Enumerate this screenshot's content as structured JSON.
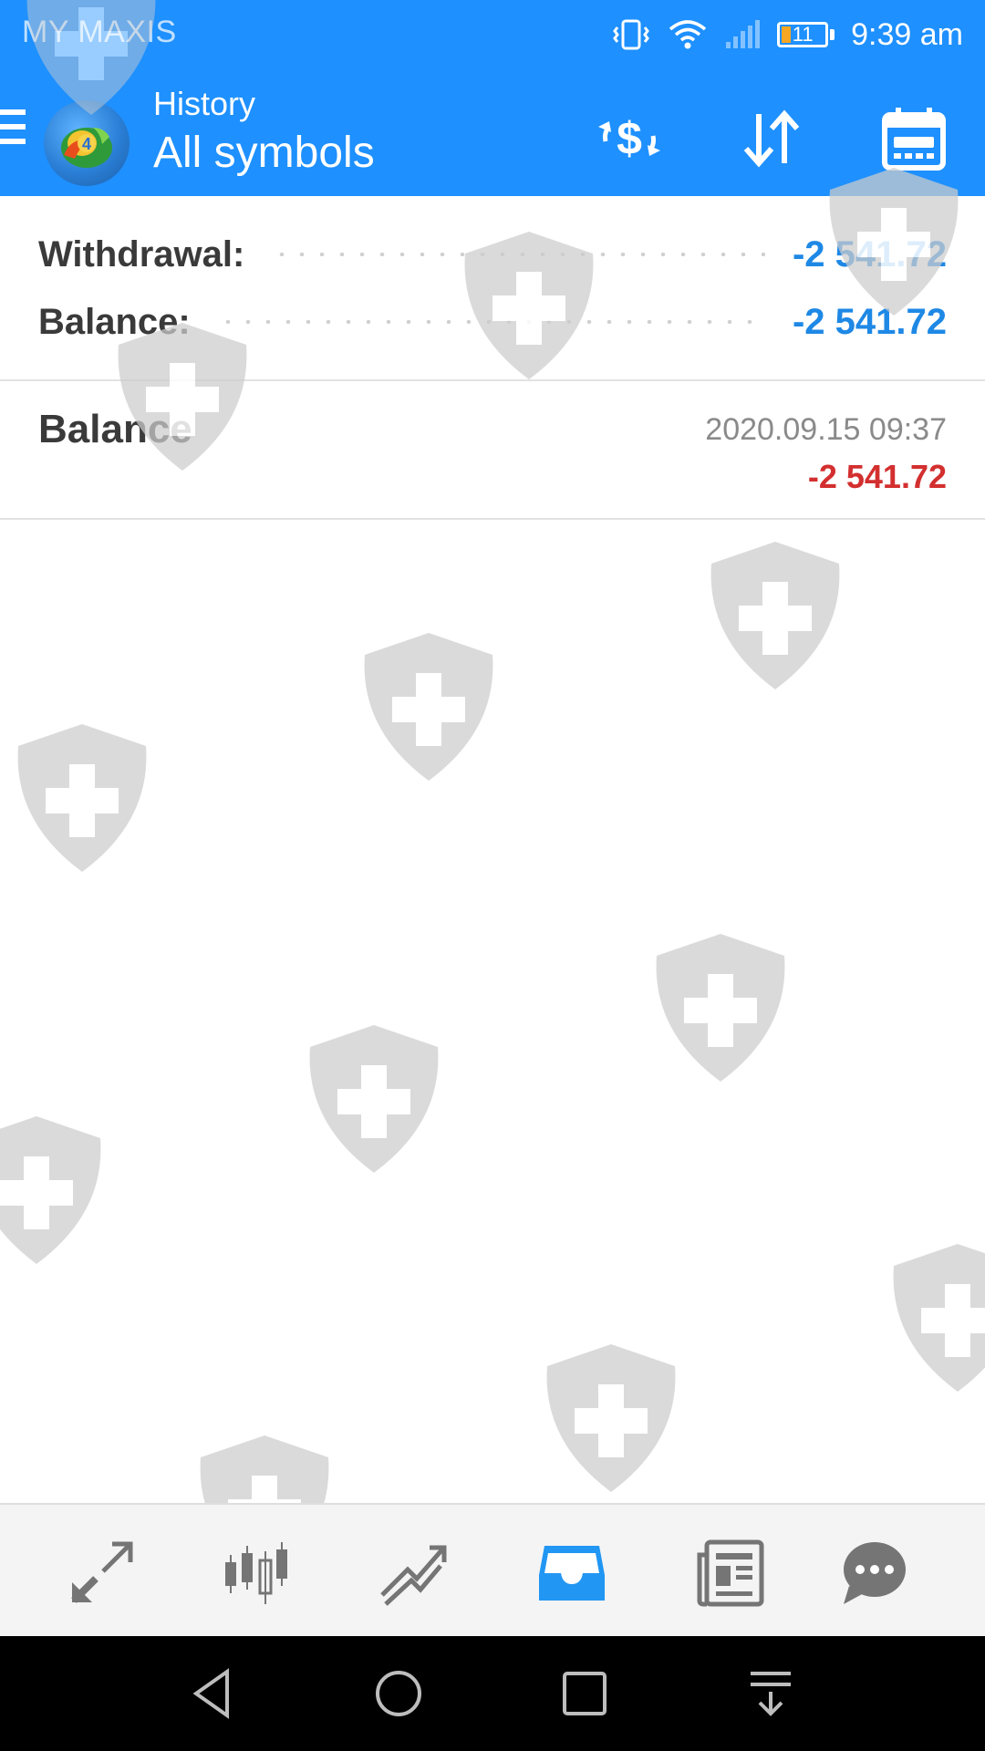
{
  "status_bar": {
    "carrier": "MY MAXIS",
    "battery_level": "11",
    "time": "9:39 am"
  },
  "app_bar": {
    "subtitle": "History",
    "title": "All symbols",
    "actions": [
      "deposit-withdraw-icon",
      "sort-icon",
      "calendar-icon"
    ]
  },
  "summary": {
    "rows": [
      {
        "label": "Withdrawal:",
        "value": "-2 541.72"
      },
      {
        "label": "Balance:",
        "value": "-2 541.72"
      }
    ]
  },
  "history": {
    "items": [
      {
        "type": "Balance",
        "time": "2020.09.15 09:37",
        "amount": "-2 541.72"
      }
    ]
  },
  "bottom_tabs": {
    "items": [
      "quotes-icon",
      "chart-icon",
      "trade-icon",
      "history-icon",
      "news-icon",
      "messages-icon"
    ],
    "active": "history-icon"
  },
  "colors": {
    "header_blue": "#1e90ff",
    "value_blue": "#1e88e5",
    "negative_red": "#d32f2f",
    "tab_active": "#2196f3",
    "tab_inactive": "#757575"
  }
}
